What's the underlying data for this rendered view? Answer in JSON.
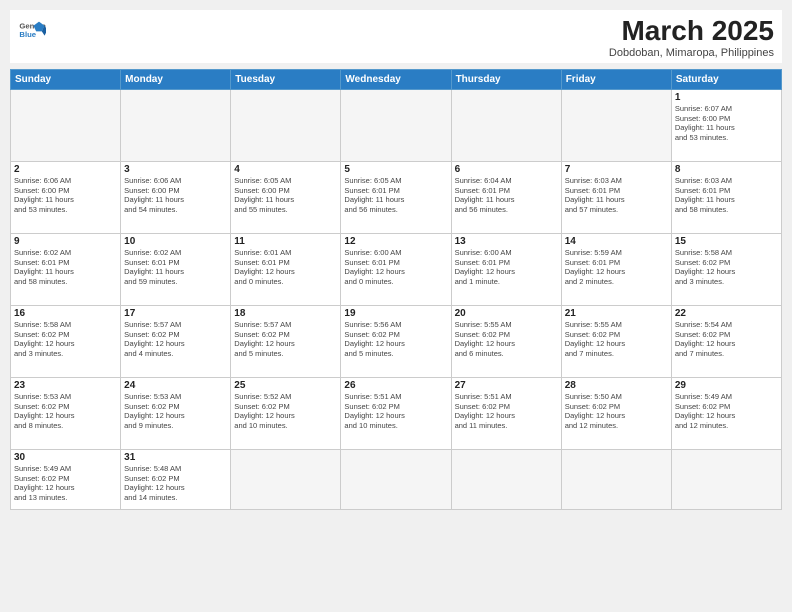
{
  "header": {
    "logo_general": "General",
    "logo_blue": "Blue",
    "month_title": "March 2025",
    "subtitle": "Dobdoban, Mimaropa, Philippines"
  },
  "weekdays": [
    "Sunday",
    "Monday",
    "Tuesday",
    "Wednesday",
    "Thursday",
    "Friday",
    "Saturday"
  ],
  "days": {
    "d1": {
      "n": "1",
      "info": "Sunrise: 6:07 AM\nSunset: 6:00 PM\nDaylight: 11 hours\nand 53 minutes."
    },
    "d2": {
      "n": "2",
      "info": "Sunrise: 6:06 AM\nSunset: 6:00 PM\nDaylight: 11 hours\nand 53 minutes."
    },
    "d3": {
      "n": "3",
      "info": "Sunrise: 6:06 AM\nSunset: 6:00 PM\nDaylight: 11 hours\nand 54 minutes."
    },
    "d4": {
      "n": "4",
      "info": "Sunrise: 6:05 AM\nSunset: 6:00 PM\nDaylight: 11 hours\nand 55 minutes."
    },
    "d5": {
      "n": "5",
      "info": "Sunrise: 6:05 AM\nSunset: 6:01 PM\nDaylight: 11 hours\nand 56 minutes."
    },
    "d6": {
      "n": "6",
      "info": "Sunrise: 6:04 AM\nSunset: 6:01 PM\nDaylight: 11 hours\nand 56 minutes."
    },
    "d7": {
      "n": "7",
      "info": "Sunrise: 6:03 AM\nSunset: 6:01 PM\nDaylight: 11 hours\nand 57 minutes."
    },
    "d8": {
      "n": "8",
      "info": "Sunrise: 6:03 AM\nSunset: 6:01 PM\nDaylight: 11 hours\nand 58 minutes."
    },
    "d9": {
      "n": "9",
      "info": "Sunrise: 6:02 AM\nSunset: 6:01 PM\nDaylight: 11 hours\nand 58 minutes."
    },
    "d10": {
      "n": "10",
      "info": "Sunrise: 6:02 AM\nSunset: 6:01 PM\nDaylight: 11 hours\nand 59 minutes."
    },
    "d11": {
      "n": "11",
      "info": "Sunrise: 6:01 AM\nSunset: 6:01 PM\nDaylight: 12 hours\nand 0 minutes."
    },
    "d12": {
      "n": "12",
      "info": "Sunrise: 6:00 AM\nSunset: 6:01 PM\nDaylight: 12 hours\nand 0 minutes."
    },
    "d13": {
      "n": "13",
      "info": "Sunrise: 6:00 AM\nSunset: 6:01 PM\nDaylight: 12 hours\nand 1 minute."
    },
    "d14": {
      "n": "14",
      "info": "Sunrise: 5:59 AM\nSunset: 6:01 PM\nDaylight: 12 hours\nand 2 minutes."
    },
    "d15": {
      "n": "15",
      "info": "Sunrise: 5:58 AM\nSunset: 6:02 PM\nDaylight: 12 hours\nand 3 minutes."
    },
    "d16": {
      "n": "16",
      "info": "Sunrise: 5:58 AM\nSunset: 6:02 PM\nDaylight: 12 hours\nand 3 minutes."
    },
    "d17": {
      "n": "17",
      "info": "Sunrise: 5:57 AM\nSunset: 6:02 PM\nDaylight: 12 hours\nand 4 minutes."
    },
    "d18": {
      "n": "18",
      "info": "Sunrise: 5:57 AM\nSunset: 6:02 PM\nDaylight: 12 hours\nand 5 minutes."
    },
    "d19": {
      "n": "19",
      "info": "Sunrise: 5:56 AM\nSunset: 6:02 PM\nDaylight: 12 hours\nand 5 minutes."
    },
    "d20": {
      "n": "20",
      "info": "Sunrise: 5:55 AM\nSunset: 6:02 PM\nDaylight: 12 hours\nand 6 minutes."
    },
    "d21": {
      "n": "21",
      "info": "Sunrise: 5:55 AM\nSunset: 6:02 PM\nDaylight: 12 hours\nand 7 minutes."
    },
    "d22": {
      "n": "22",
      "info": "Sunrise: 5:54 AM\nSunset: 6:02 PM\nDaylight: 12 hours\nand 7 minutes."
    },
    "d23": {
      "n": "23",
      "info": "Sunrise: 5:53 AM\nSunset: 6:02 PM\nDaylight: 12 hours\nand 8 minutes."
    },
    "d24": {
      "n": "24",
      "info": "Sunrise: 5:53 AM\nSunset: 6:02 PM\nDaylight: 12 hours\nand 9 minutes."
    },
    "d25": {
      "n": "25",
      "info": "Sunrise: 5:52 AM\nSunset: 6:02 PM\nDaylight: 12 hours\nand 10 minutes."
    },
    "d26": {
      "n": "26",
      "info": "Sunrise: 5:51 AM\nSunset: 6:02 PM\nDaylight: 12 hours\nand 10 minutes."
    },
    "d27": {
      "n": "27",
      "info": "Sunrise: 5:51 AM\nSunset: 6:02 PM\nDaylight: 12 hours\nand 11 minutes."
    },
    "d28": {
      "n": "28",
      "info": "Sunrise: 5:50 AM\nSunset: 6:02 PM\nDaylight: 12 hours\nand 12 minutes."
    },
    "d29": {
      "n": "29",
      "info": "Sunrise: 5:49 AM\nSunset: 6:02 PM\nDaylight: 12 hours\nand 12 minutes."
    },
    "d30": {
      "n": "30",
      "info": "Sunrise: 5:49 AM\nSunset: 6:02 PM\nDaylight: 12 hours\nand 13 minutes."
    },
    "d31": {
      "n": "31",
      "info": "Sunrise: 5:48 AM\nSunset: 6:02 PM\nDaylight: 12 hours\nand 14 minutes."
    }
  }
}
